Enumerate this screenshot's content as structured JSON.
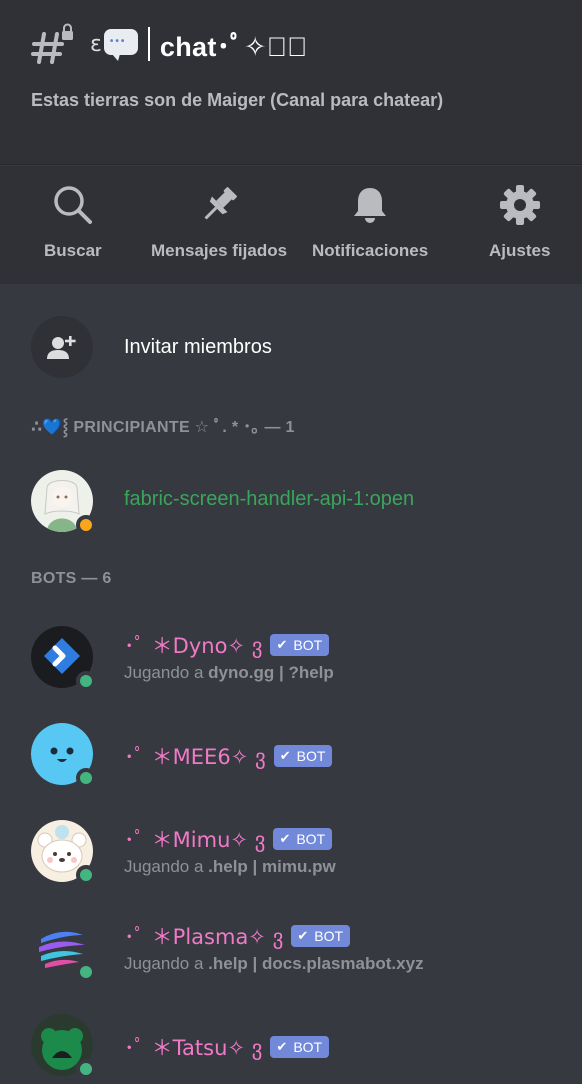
{
  "channel": {
    "name_emoji": "ɛ",
    "name": "chat･ﾟ✧₊ﾟ",
    "topic": "Estas tierras son de Maiger (Canal para chatear)"
  },
  "toolbar": {
    "search_label": "Buscar",
    "pinned_label": "Mensajes fijados",
    "notifications_label": "Notificaciones",
    "settings_label": "Ajustes"
  },
  "invite": {
    "label": "Invitar miembros"
  },
  "sections": {
    "principiante": "∴💙⸾ PRINCIPIANTE ☆ ﾟ. * ･｡ — 1",
    "bots": "BOTS — 6"
  },
  "members": [
    {
      "name": "fabric-screen-handler-api-1:open",
      "status": "idle"
    }
  ],
  "bots": [
    {
      "name": "･ﾟ ＊Dyno✧ ვ",
      "tag": "BOT",
      "activity_prefix": "Jugando a ",
      "activity": "dyno.gg | ?help"
    },
    {
      "name": "･ﾟ ＊MEE6✧ ვ",
      "tag": "BOT",
      "activity_prefix": "",
      "activity": ""
    },
    {
      "name": "･ﾟ ＊Mimu✧ ვ",
      "tag": "BOT",
      "activity_prefix": "Jugando a ",
      "activity": ".help | mimu.pw"
    },
    {
      "name": "･ﾟ ＊Plasma✧ ვ",
      "tag": "BOT",
      "activity_prefix": "Jugando a ",
      "activity": ".help | docs.plasmabot.xyz"
    },
    {
      "name": "･ﾟ ＊Tatsu✧ ვ",
      "tag": "BOT",
      "activity_prefix": "",
      "activity": ""
    }
  ],
  "colors": {
    "background": "#36393f",
    "header_bg": "#2f3136",
    "bot_name": "#f17ac8",
    "bot_tag": "#7289da",
    "online": "#43b581",
    "idle": "#faa61a",
    "member_green": "#3ba55c"
  },
  "icons": [
    "locked-hash-icon",
    "speech-bubble-icon",
    "search-icon",
    "pin-icon",
    "bell-icon",
    "gear-icon",
    "add-user-icon"
  ]
}
